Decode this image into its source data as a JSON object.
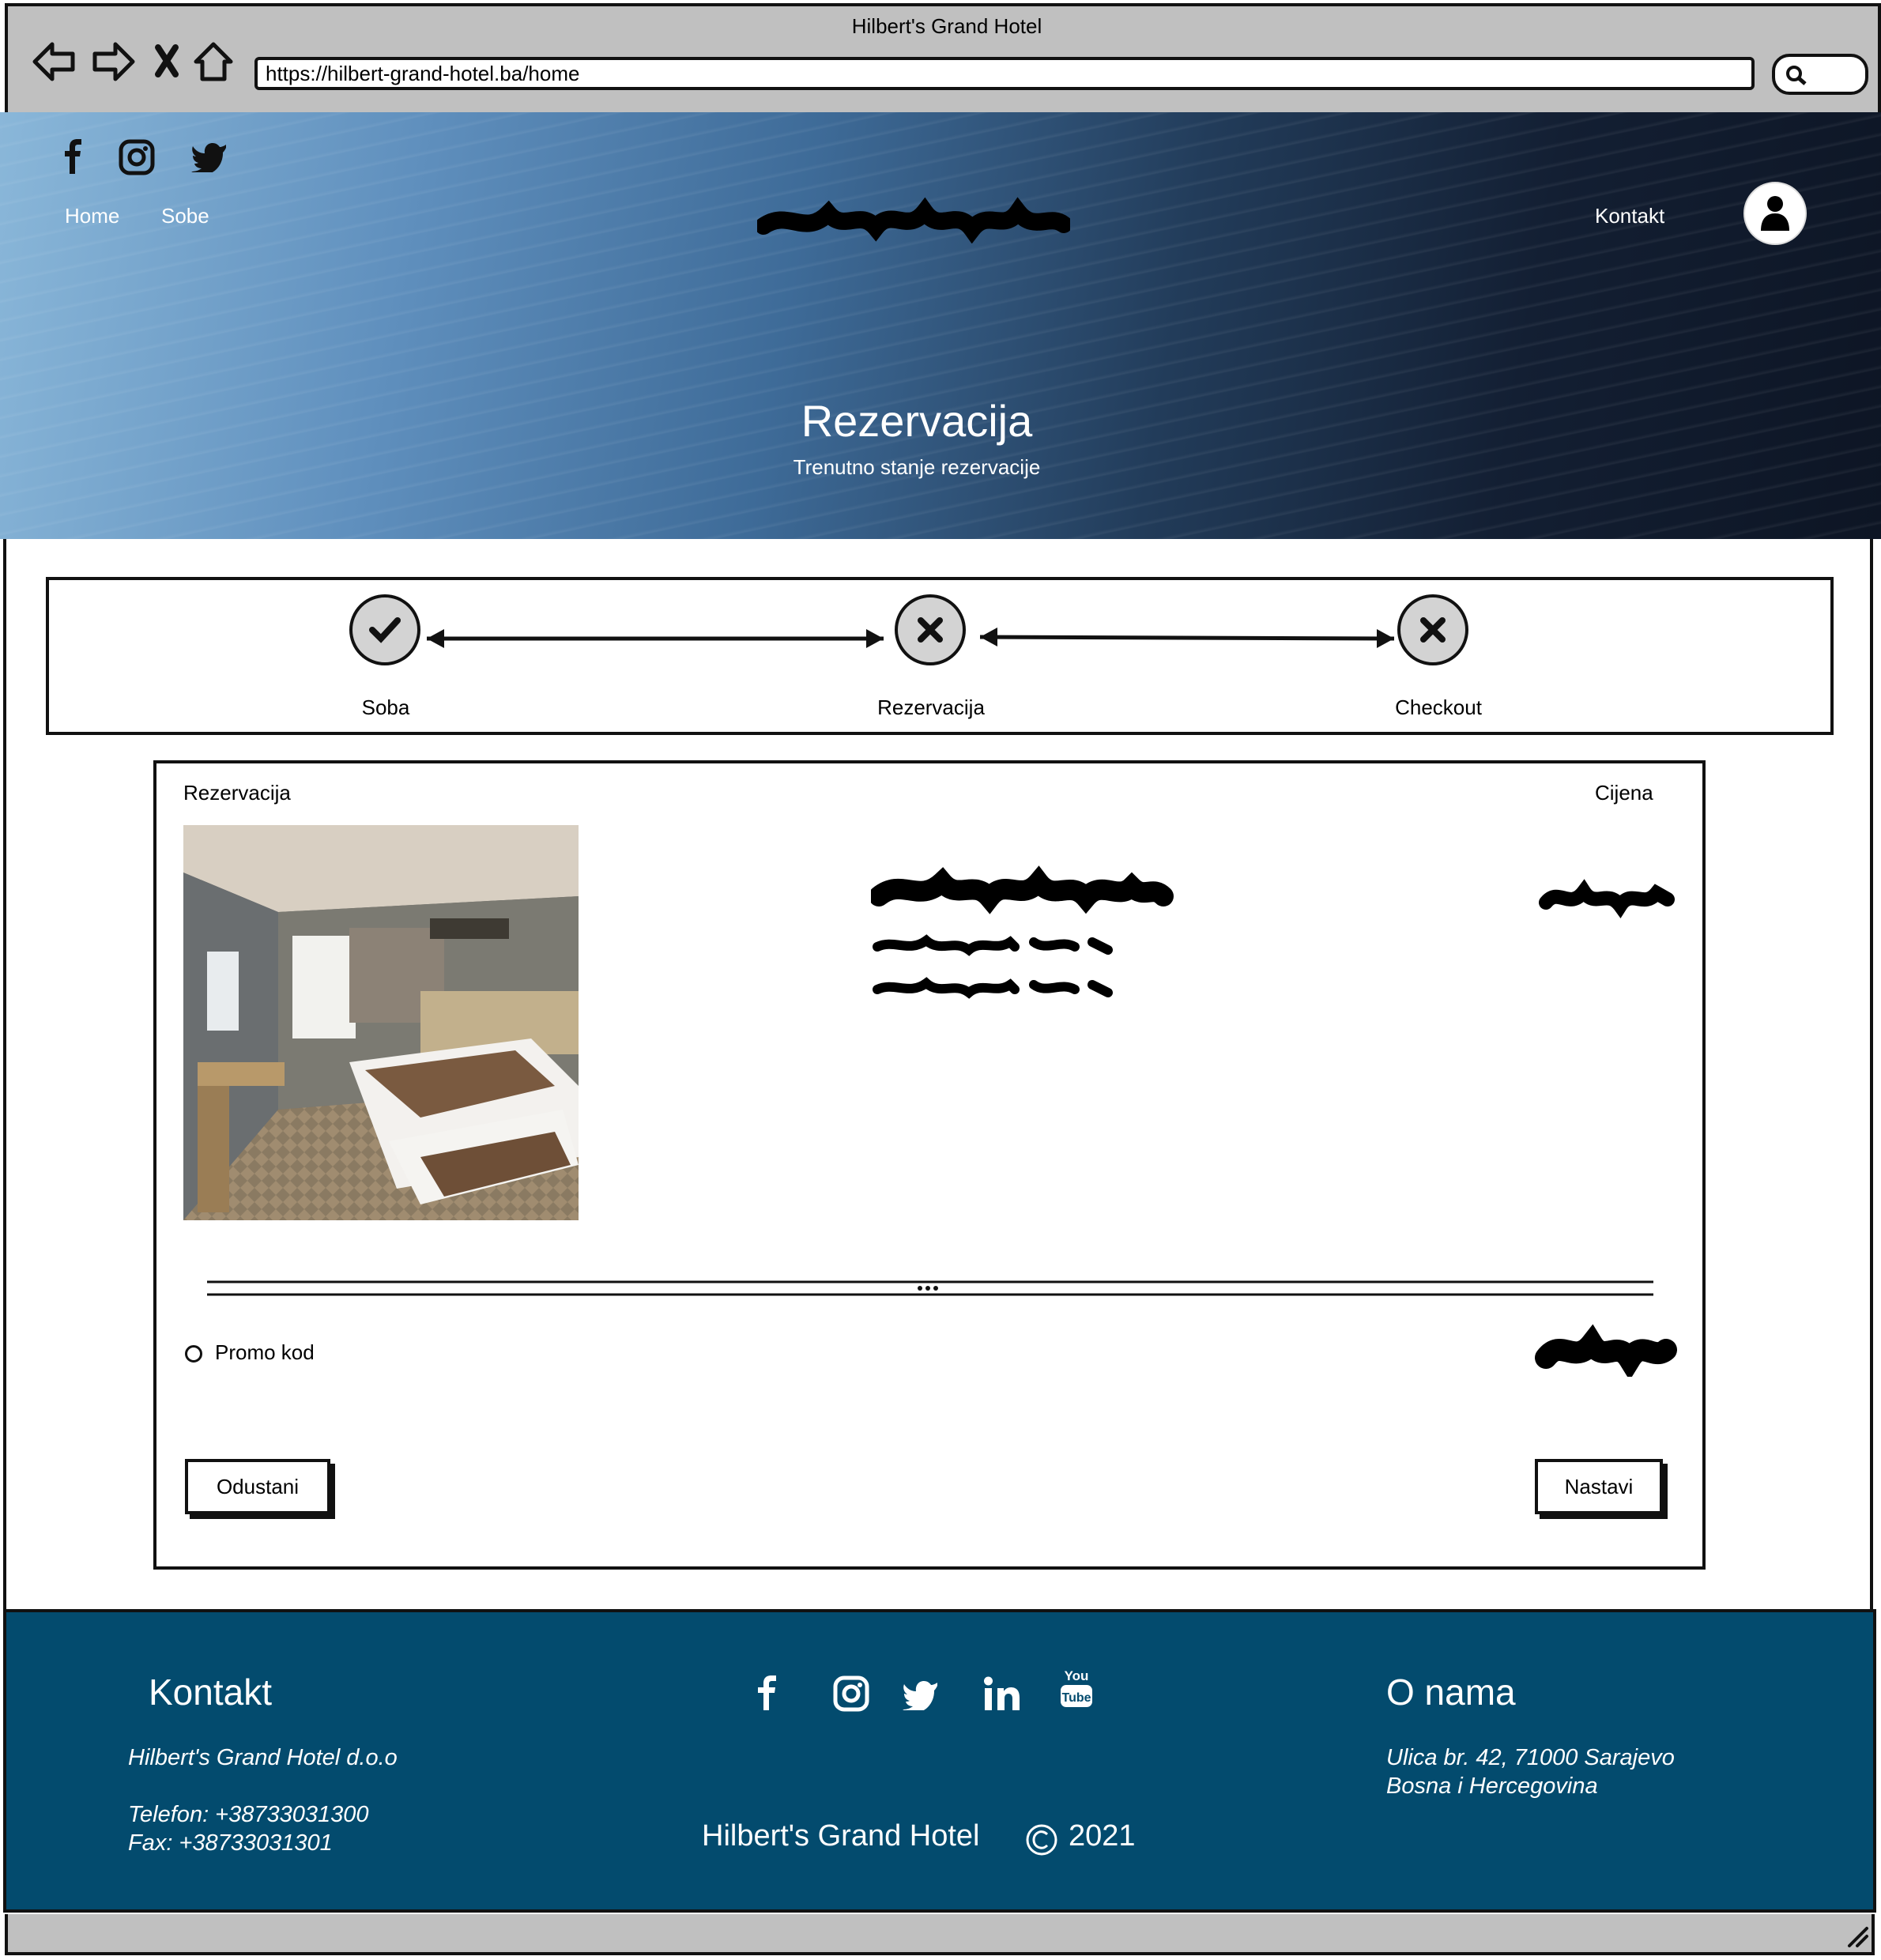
{
  "browser": {
    "title": "Hilbert's Grand Hotel",
    "url": "https://hilbert-grand-hotel.ba/home"
  },
  "header": {
    "social_icons": [
      "facebook-icon",
      "instagram-icon",
      "twitter-icon"
    ],
    "nav": {
      "home": "Home",
      "sobe": "Sobe",
      "kontakt": "Kontakt"
    },
    "hero_title": "Rezervacija",
    "hero_subtitle": "Trenutno stanje rezervacije"
  },
  "stepper": {
    "steps": [
      {
        "label": "Soba",
        "status": "done",
        "icon": "check-icon"
      },
      {
        "label": "Rezervacija",
        "status": "pending",
        "icon": "x-icon"
      },
      {
        "label": "Checkout",
        "status": "pending",
        "icon": "x-icon"
      }
    ]
  },
  "card": {
    "col_left": "Rezervacija",
    "col_right": "Cijena",
    "promo_label": "Promo kod",
    "cancel_label": "Odustani",
    "continue_label": "Nastavi"
  },
  "footer": {
    "kontakt_title": "Kontakt",
    "company": "Hilbert's Grand Hotel d.o.o",
    "phone": "Telefon: +38733031300",
    "fax": "Fax: +38733031301",
    "social_icons": [
      "facebook-icon",
      "instagram-icon",
      "twitter-icon",
      "linkedin-icon",
      "youtube-icon"
    ],
    "copyright_name": "Hilbert's Grand Hotel",
    "copyright_year": "2021",
    "about_title": "O nama",
    "address_line1": "Ulica br. 42, 71000 Sarajevo",
    "address_line2": "Bosna i Hercegovina"
  },
  "colors": {
    "footer_bg": "#034b6e",
    "chrome_bg": "#c0c0c0",
    "step_circle": "#d3d3d3"
  }
}
